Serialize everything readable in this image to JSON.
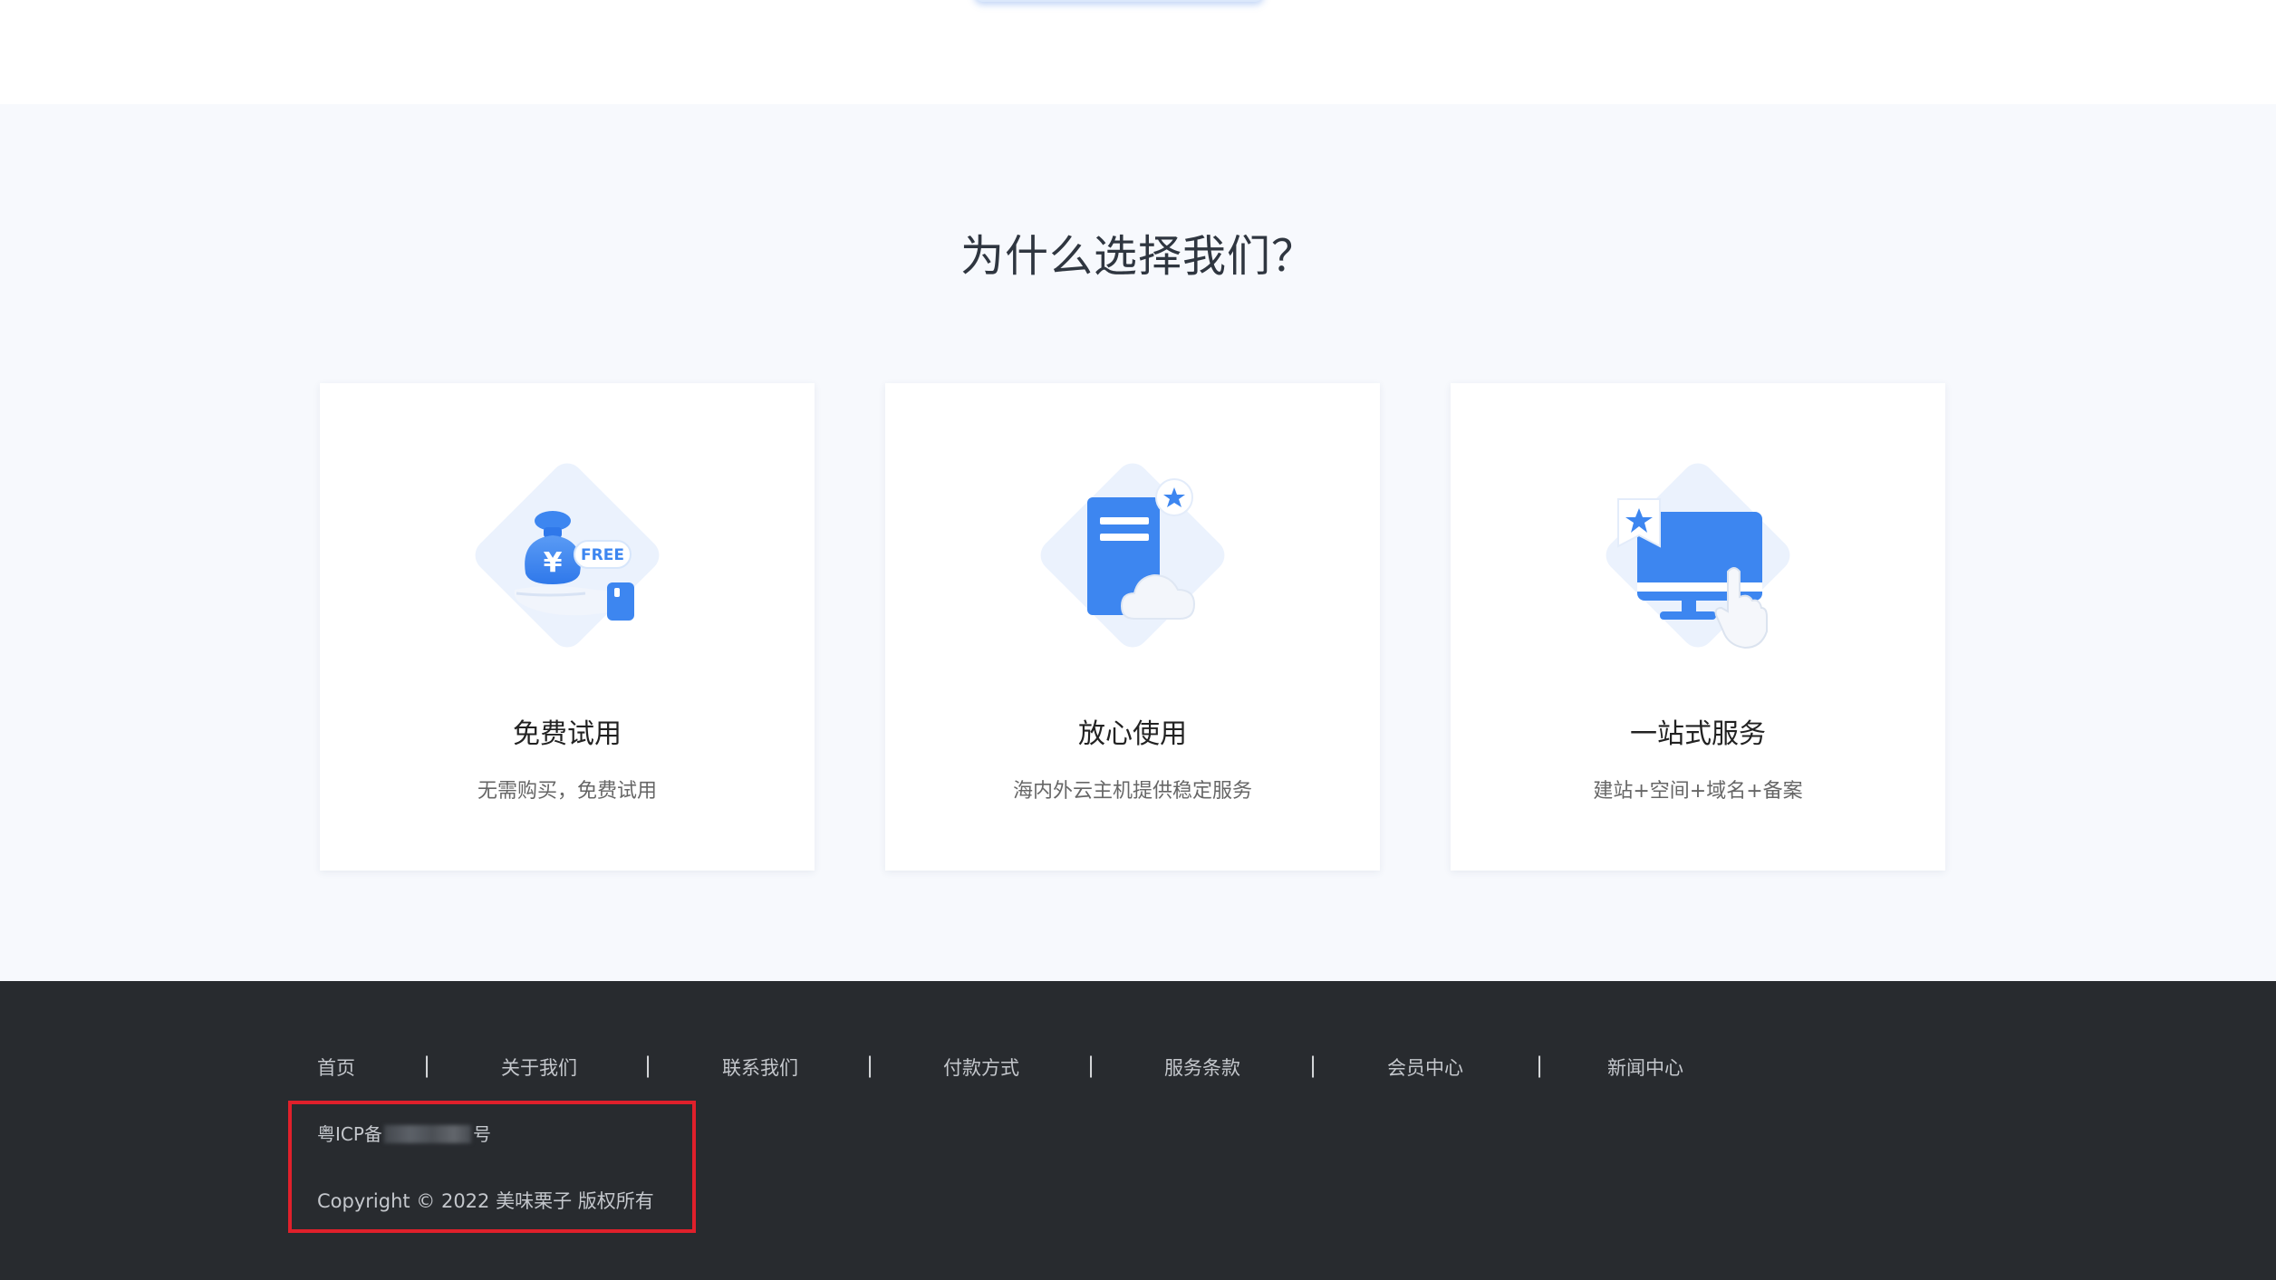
{
  "section": {
    "title": "为什么选择我们？"
  },
  "cards": [
    {
      "icon": "money-bag-free-icon",
      "title": "免费试用",
      "description": "无需购买，免费试用",
      "icon_text": "FREE",
      "currency_symbol": "¥"
    },
    {
      "icon": "document-cloud-icon",
      "title": "放心使用",
      "description": "海内外云主机提供稳定服务"
    },
    {
      "icon": "monitor-click-icon",
      "title": "一站式服务",
      "description": "建站+空间+域名+备案"
    }
  ],
  "footer": {
    "nav": [
      {
        "label": "首页"
      },
      {
        "label": "关于我们"
      },
      {
        "label": "联系我们"
      },
      {
        "label": "付款方式"
      },
      {
        "label": "服务条款"
      },
      {
        "label": "会员中心"
      },
      {
        "label": "新闻中心"
      }
    ],
    "separator": "|",
    "icp_prefix": "粤ICP备",
    "icp_suffix": "号",
    "copyright": "Copyright © 2022 美味栗子 版权所有"
  },
  "colors": {
    "accent_blue": "#3d86f0",
    "footer_bg": "#282b2f",
    "section_bg": "#f7f9fd",
    "highlight_red": "#e0202b"
  }
}
